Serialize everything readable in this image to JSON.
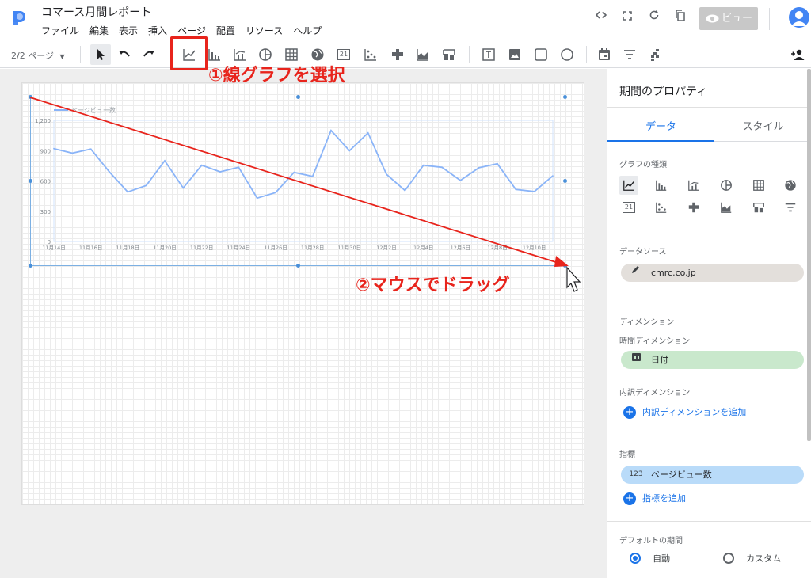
{
  "header": {
    "title": "コマース月間レポート",
    "menu": [
      "ファイル",
      "編集",
      "表示",
      "挿入",
      "ページ",
      "配置",
      "リソース",
      "ヘルプ"
    ],
    "view_button": "ビュー",
    "icons": [
      "code-icon",
      "fullscreen-icon",
      "refresh-icon",
      "copy-icon",
      "eye-icon",
      "avatar-icon"
    ]
  },
  "toolbar": {
    "page_selector": "2/2 ページ",
    "tools": [
      "select-icon",
      "undo-icon",
      "redo-icon",
      "line-chart-icon",
      "bar-chart-icon",
      "combo-chart-icon",
      "pie-chart-icon",
      "table-icon",
      "geo-map-icon",
      "scorecard-icon",
      "scatter-icon",
      "pivot-table-icon",
      "area-chart-icon",
      "bullet-chart-icon",
      "text-icon",
      "image-icon",
      "rectangle-icon",
      "circle-icon",
      "date-range-icon",
      "filter-icon",
      "data-control-icon",
      "add-user-icon"
    ],
    "scorecard_label": "21"
  },
  "annotations": {
    "step1": "①線グラフを選択",
    "step2": "②マウスでドラッグ",
    "color": "#e8241c"
  },
  "chart_data": {
    "type": "line",
    "series": [
      {
        "name": "ページビュー数",
        "values": [
          920,
          875,
          915,
          690,
          490,
          555,
          800,
          530,
          755,
          690,
          735,
          430,
          485,
          685,
          645,
          1100,
          900,
          1075,
          665,
          505,
          755,
          735,
          605,
          730,
          770,
          515,
          495,
          650
        ]
      }
    ],
    "x_tick_labels": [
      "11月14日",
      "11月16日",
      "11月18日",
      "11月20日",
      "11月22日",
      "11月24日",
      "11月26日",
      "11月28日",
      "11月30日",
      "12月2日",
      "12月4日",
      "12月6日",
      "12月8日",
      "12月10日"
    ],
    "y_tick_labels": [
      "0",
      "300",
      "600",
      "900",
      "1,200"
    ],
    "ylim": [
      0,
      1200
    ],
    "legend_position": "top-left",
    "grid": false,
    "line_color": "#8ab4f8"
  },
  "panel": {
    "title": "期間のプロパティ",
    "tabs": [
      "データ",
      "スタイル"
    ],
    "chart_type_label": "グラフの種類",
    "data_source_label": "データソース",
    "data_source": "cmrc.co.jp",
    "dimension_label": "ディメンション",
    "time_dimension_label": "時間ディメンション",
    "time_dimension": "日付",
    "breakdown_label": "内訳ディメンション",
    "add_breakdown": "内訳ディメンションを追加",
    "metric_label": "指標",
    "metric_badge": "123",
    "metric": "ページビュー数",
    "add_metric": "指標を追加",
    "default_range_label": "デフォルトの期間",
    "range_auto": "自動",
    "range_custom": "カスタム",
    "chart_types": [
      "line-chart-icon",
      "bar-chart-icon",
      "combo-chart-icon",
      "pie-chart-icon",
      "table-icon",
      "geo-map-icon",
      "scorecard-icon",
      "scatter-icon",
      "pivot-table-icon",
      "area-chart-icon",
      "bullet-chart-icon",
      "data-control-icon"
    ],
    "accent": "#1a73e8"
  }
}
